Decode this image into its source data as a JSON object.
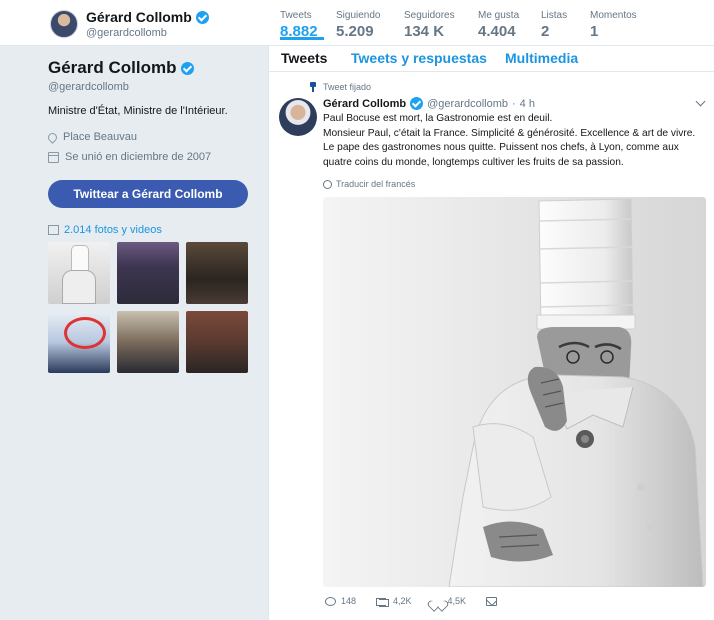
{
  "topbar": {
    "name": "Gérard Collomb",
    "handle": "@gerardcollomb",
    "stats": [
      {
        "label": "Tweets",
        "value": "8.882"
      },
      {
        "label": "Siguiendo",
        "value": "5.209"
      },
      {
        "label": "Seguidores",
        "value": "134 K"
      },
      {
        "label": "Me gusta",
        "value": "4.404"
      },
      {
        "label": "Listas",
        "value": "2"
      },
      {
        "label": "Momentos",
        "value": "1"
      }
    ]
  },
  "profile": {
    "name": "Gérard Collomb",
    "handle": "@gerardcollomb",
    "bio": "Ministre d'État, Ministre de l'Intérieur.",
    "location": "Place Beauvau",
    "joined": "Se unió en diciembre de 2007",
    "tweet_button": "Twittear a Gérard Collomb",
    "media_link": "2.014 fotos y videos"
  },
  "tabs": [
    "Tweets",
    "Tweets y respuestas",
    "Multimedia"
  ],
  "tweet": {
    "pinned_label": "Tweet fijado",
    "name": "Gérard Collomb",
    "handle": "@gerardcollomb",
    "separator": "·",
    "time": "4 h",
    "lines": [
      "Paul Bocuse est mort, la Gastronomie est en deuil.",
      "Monsieur Paul, c'était la France. Simplicité & générosité. Excellence & art de vivre.",
      "Le pape des gastronomes nous quitte. Puissent nos chefs, à Lyon, comme aux quatre coins du monde, longtemps cultiver les fruits de sa passion."
    ],
    "translate": "Traducir del francés",
    "replies": "148",
    "retweets": "4,2K",
    "likes": "4,5K"
  },
  "colors": {
    "accent": "#1da1f2",
    "button": "#3b5bb0",
    "background": "#e6ecf0"
  }
}
